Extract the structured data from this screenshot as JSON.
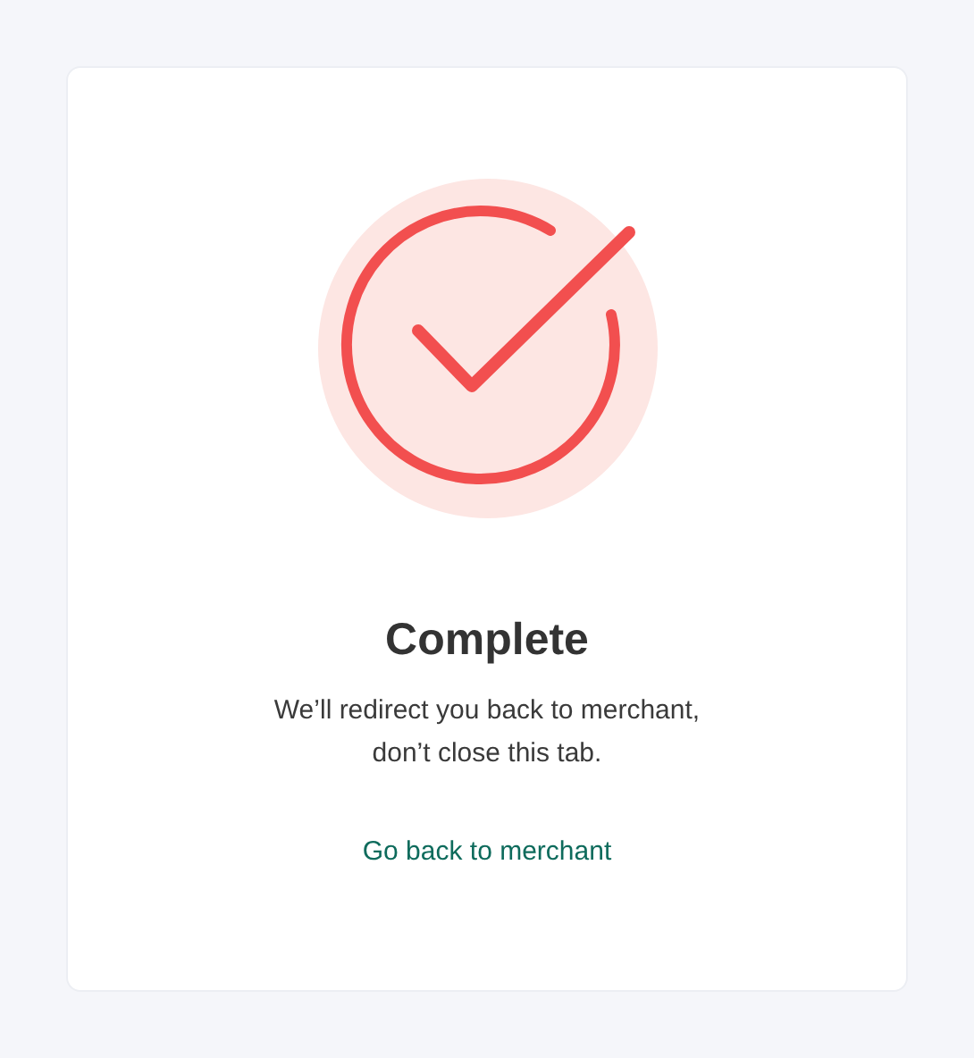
{
  "status": {
    "kind": "success",
    "title": "Complete",
    "message": "We’ll redirect you back to merchant,\ndon’t close this tab."
  },
  "link": {
    "label": "Go back to merchant"
  }
}
